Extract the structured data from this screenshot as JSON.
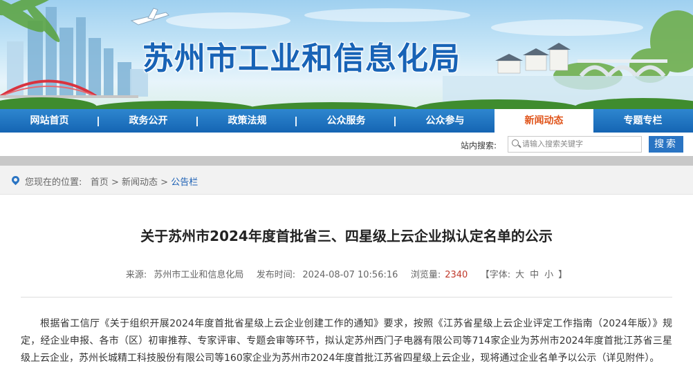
{
  "site": {
    "title": "苏州市工业和信息化局"
  },
  "nav": {
    "items": [
      {
        "label": "网站首页",
        "active": false
      },
      {
        "label": "政务公开",
        "active": false
      },
      {
        "label": "政策法规",
        "active": false
      },
      {
        "label": "公众服务",
        "active": false
      },
      {
        "label": "公众参与",
        "active": false
      },
      {
        "label": "新闻动态",
        "active": true
      },
      {
        "label": "专题专栏",
        "active": false
      }
    ]
  },
  "search": {
    "label": "站内搜索:",
    "placeholder": "请输入搜索关键字",
    "button": "搜索"
  },
  "breadcrumb": {
    "prefix": "您现在的位置:",
    "home": "首页",
    "section": "新闻动态",
    "current": "公告栏",
    "sep": ">"
  },
  "article": {
    "title": "关于苏州市2024年度首批省三、四星级上云企业拟认定名单的公示",
    "source_label": "来源:",
    "source": "苏州市工业和信息化局",
    "date_label": "发布时间:",
    "date": "2024-08-07 10:56:16",
    "views_label": "浏览量:",
    "views": "2340",
    "font_open": "【字体:",
    "font_large": "大",
    "font_medium": "中",
    "font_small": "小",
    "font_close": "】",
    "body": "根据省工信厅《关于组织开展2024年度首批省星级上云企业创建工作的通知》要求，按照《江苏省星级上云企业评定工作指南（2024年版）》规定，经企业申报、各市（区）初审推荐、专家评审、专题会审等环节，拟认定苏州西门子电器有限公司等714家企业为苏州市2024年度首批江苏省三星级上云企业，苏州长城精工科技股份有限公司等160家企业为苏州市2024年度首批江苏省四星级上云企业，现将通过企业名单予以公示（详见附件）。"
  },
  "colors": {
    "nav": "#1f74c1",
    "active_tab_text": "#e0541a",
    "title_blue": "#1863b6",
    "views": "#c0392b"
  }
}
